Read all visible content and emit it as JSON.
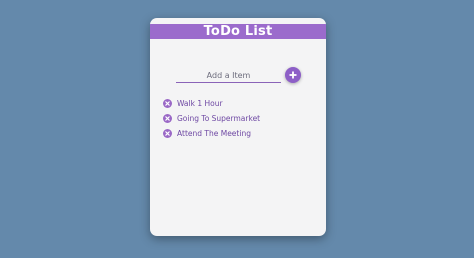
{
  "app": {
    "title": "ToDo List"
  },
  "add_form": {
    "placeholder": "Add a Item",
    "button_icon": "plus-icon"
  },
  "todos": [
    {
      "label": "Walk 1 Hour",
      "icon": "remove-icon"
    },
    {
      "label": "Going To Supermarket",
      "icon": "remove-icon"
    },
    {
      "label": "Attend The Meeting",
      "icon": "remove-icon"
    }
  ],
  "colors": {
    "background": "#6489ab",
    "card": "#f4f4f5",
    "header": "#9b6bcc",
    "accent": "#8d5fc7",
    "item_text": "#6e48a3"
  }
}
